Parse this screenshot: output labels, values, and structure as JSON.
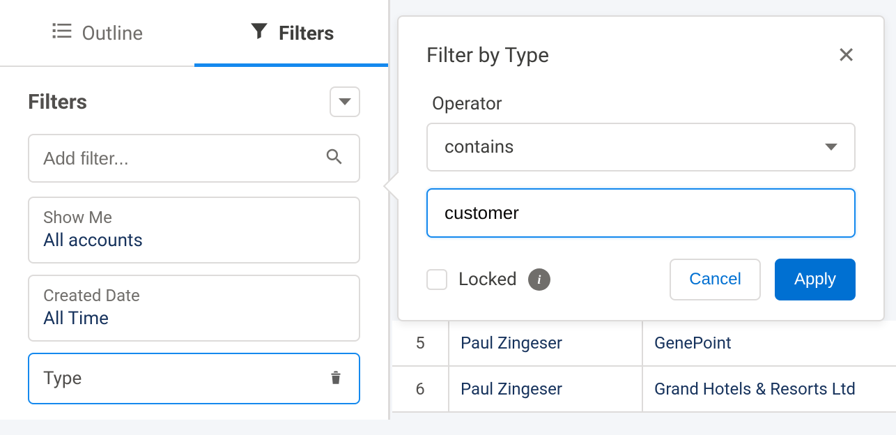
{
  "tabs": {
    "outline": "Outline",
    "filters": "Filters"
  },
  "sidebar": {
    "title": "Filters",
    "addFilterPlaceholder": "Add filter...",
    "showMe": {
      "label": "Show Me",
      "value": "All accounts"
    },
    "createdDate": {
      "label": "Created Date",
      "value": "All Time"
    },
    "typeFilter": {
      "label": "Type"
    }
  },
  "popover": {
    "title": "Filter by Type",
    "operatorLabel": "Operator",
    "operatorValue": "contains",
    "filterValue": "customer",
    "lockedLabel": "Locked",
    "cancelLabel": "Cancel",
    "applyLabel": "Apply"
  },
  "table": {
    "rows": [
      {
        "num": "5",
        "owner": "Paul Zingeser",
        "account": "GenePoint"
      },
      {
        "num": "6",
        "owner": "Paul Zingeser",
        "account": "Grand Hotels & Resorts Ltd"
      }
    ]
  }
}
